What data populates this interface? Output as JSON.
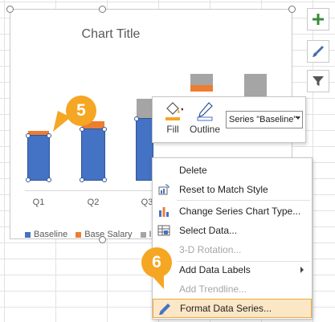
{
  "chart": {
    "title": "Chart Title",
    "categories": [
      "Q1",
      "Q2",
      "Q3"
    ],
    "legend": [
      {
        "label": "Baseline",
        "color": "#4472c4"
      },
      {
        "label": "Base Salary",
        "color": "#ed7d31"
      },
      {
        "label": "In",
        "color": "#a5a5a5"
      }
    ]
  },
  "callouts": {
    "step5": "5",
    "step6": "6"
  },
  "mini_toolbar": {
    "fill_label": "Fill",
    "outline_label": "Outline",
    "series_selector": "Series \"Baseline\""
  },
  "context_menu": {
    "items": [
      {
        "label": "Delete",
        "enabled": true
      },
      {
        "label": "Reset to Match Style",
        "enabled": true
      },
      {
        "label": "Change Series Chart Type...",
        "enabled": true
      },
      {
        "label": "Select Data...",
        "enabled": true
      },
      {
        "label": "3-D Rotation...",
        "enabled": false
      },
      {
        "label": "Add Data Labels",
        "enabled": true
      },
      {
        "label": "Add Trendline...",
        "enabled": false
      },
      {
        "label": "Format Data Series...",
        "enabled": true
      }
    ]
  },
  "side_buttons": [
    "chart-elements-icon",
    "chart-styles-icon",
    "chart-filters-icon"
  ],
  "colors": {
    "accent": "#f5a623",
    "series_blue": "#4472c4",
    "series_orange": "#ed7d31",
    "series_gray": "#a5a5a5"
  }
}
